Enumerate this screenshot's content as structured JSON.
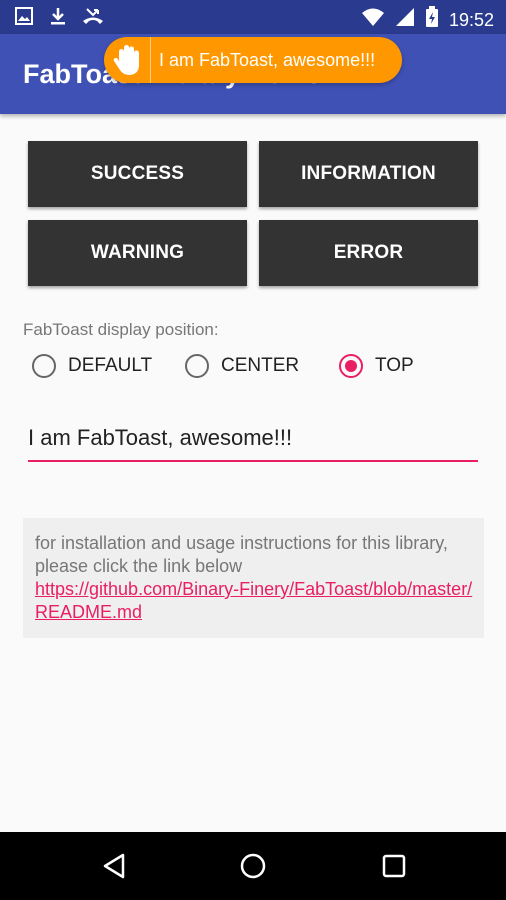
{
  "status_bar": {
    "time": "19:52",
    "icons": [
      "image-icon",
      "download-icon",
      "missed-call-icon",
      "wifi-icon",
      "signal-icon",
      "battery-icon"
    ]
  },
  "app_bar": {
    "title": "FabToast Library Demo",
    "color": "#3f51b5"
  },
  "toast": {
    "message": "I am FabToast, awesome!!!",
    "icon": "hand-icon",
    "color": "#ff9800"
  },
  "buttons": {
    "success": "SUCCESS",
    "information": "INFORMATION",
    "warning": "WARNING",
    "error": "ERROR"
  },
  "position": {
    "label": "FabToast display position:",
    "options": [
      "DEFAULT",
      "CENTER",
      "TOP"
    ],
    "selected": "TOP"
  },
  "message_input": {
    "value": "I am FabToast, awesome!!!"
  },
  "info": {
    "text": "for installation and usage instructions for this library, please click the link below",
    "link": "https://github.com/Binary-Finery/FabToast/blob/master/README.md"
  },
  "colors": {
    "accent": "#e91e63",
    "button_bg": "#333333",
    "status_bar": "#2a3a8f"
  }
}
